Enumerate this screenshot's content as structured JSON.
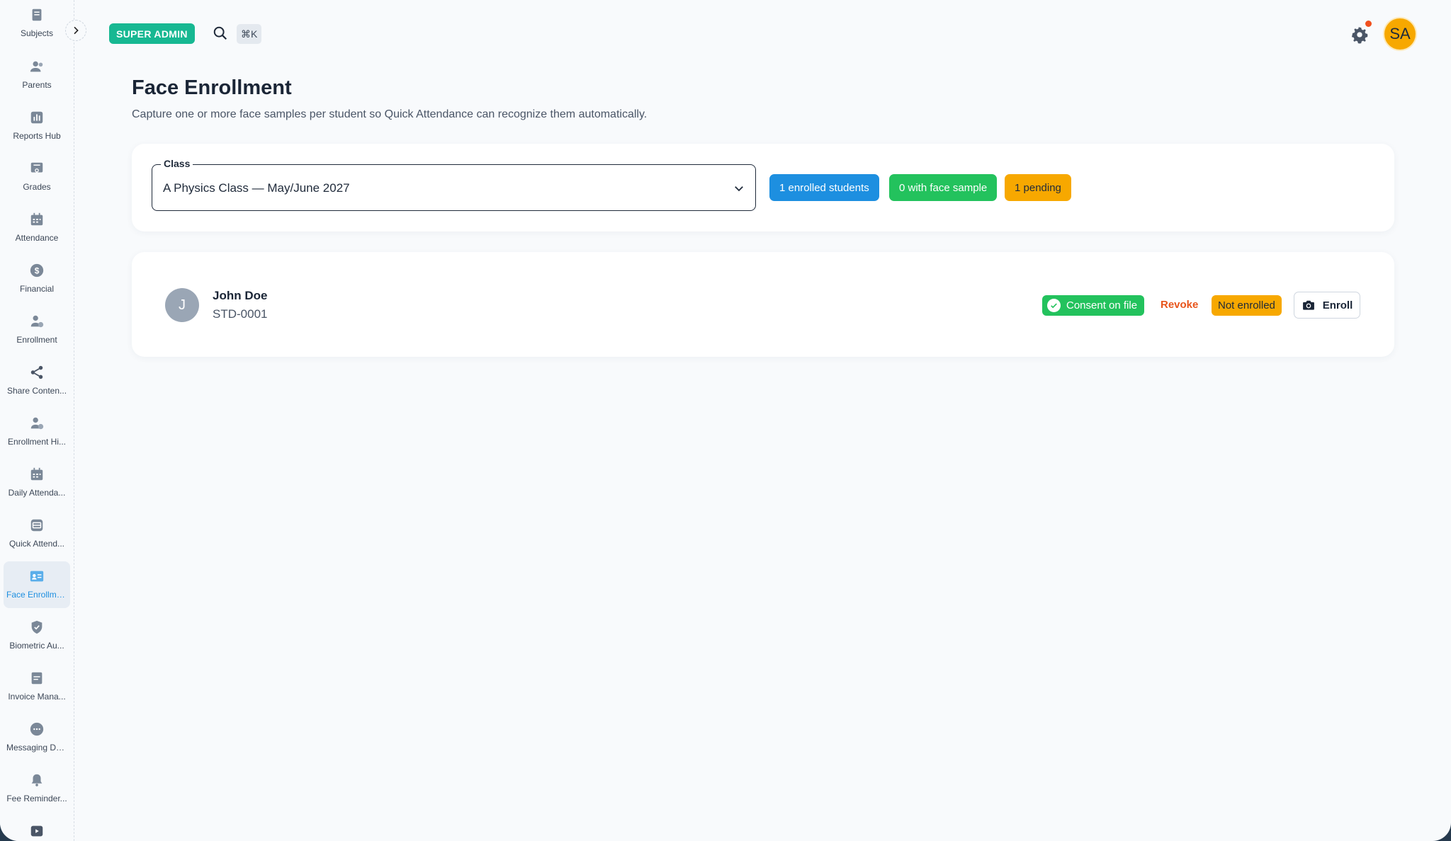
{
  "sidebar": {
    "items": [
      {
        "label": "Subjects",
        "icon": "book-icon"
      },
      {
        "label": "Parents",
        "icon": "users-icon"
      },
      {
        "label": "Reports Hub",
        "icon": "bar-chart-icon"
      },
      {
        "label": "Grades",
        "icon": "grades-icon"
      },
      {
        "label": "Attendance",
        "icon": "calendar-icon"
      },
      {
        "label": "Financial",
        "icon": "dollar-icon"
      },
      {
        "label": "Enrollment",
        "icon": "user-plus-icon"
      },
      {
        "label": "Share Conten...",
        "icon": "share-icon"
      },
      {
        "label": "Enrollment Hi...",
        "icon": "user-history-icon"
      },
      {
        "label": "Daily Attenda...",
        "icon": "calendar-icon"
      },
      {
        "label": "Quick Attend...",
        "icon": "scan-icon"
      },
      {
        "label": "Face Enrollme...",
        "icon": "id-card-icon",
        "active": true
      },
      {
        "label": "Biometric Au...",
        "icon": "shield-check-icon"
      },
      {
        "label": "Invoice Mana...",
        "icon": "invoice-icon"
      },
      {
        "label": "Messaging Da...",
        "icon": "chat-icon"
      },
      {
        "label": "Fee Reminder...",
        "icon": "bell-icon"
      },
      {
        "label": "",
        "icon": "video-icon"
      }
    ]
  },
  "topbar": {
    "role_badge": "SUPER ADMIN",
    "shortcut": "⌘K",
    "avatar_initials": "SA"
  },
  "page": {
    "title": "Face Enrollment",
    "subtitle": "Capture one or more face samples per student so Quick Attendance can recognize them automatically."
  },
  "filter": {
    "class_label": "Class",
    "class_value": "A Physics Class — May/June 2027",
    "stats": {
      "enrolled": "1 enrolled students",
      "with_sample": "0 with face sample",
      "pending": "1 pending"
    }
  },
  "students": [
    {
      "initial": "J",
      "name": "John Doe",
      "id": "STD-0001",
      "consent": "Consent on file",
      "revoke": "Revoke",
      "status": "Not enrolled",
      "enroll": "Enroll"
    }
  ],
  "colors": {
    "accent_blue": "#1d8fe0",
    "success_green": "#23c25d",
    "warning_orange": "#f7a800",
    "danger_orange": "#e8541a",
    "badge_teal": "#17b892"
  }
}
